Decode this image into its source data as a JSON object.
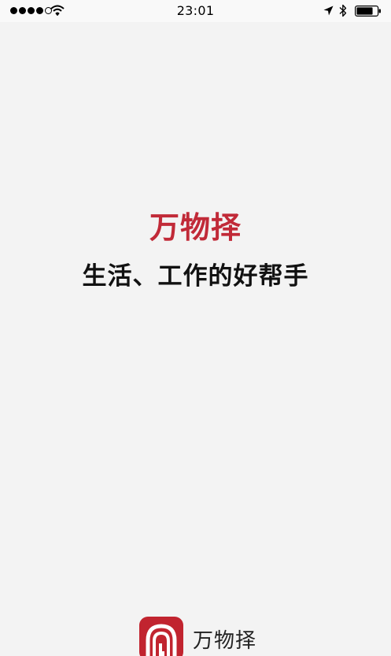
{
  "status_bar": {
    "time": "23:01",
    "signal_bars_filled": 4,
    "signal_bars_total": 5,
    "icons": [
      "wifi-icon",
      "location-arrow-icon",
      "bluetooth-icon",
      "battery-icon"
    ],
    "battery_level": 0.8
  },
  "splash": {
    "title": "万物择",
    "slogan": "生活、工作的好帮手",
    "title_color": "#c12a38"
  },
  "brand": {
    "name": "万物择",
    "logo_color": "#c1242f"
  }
}
